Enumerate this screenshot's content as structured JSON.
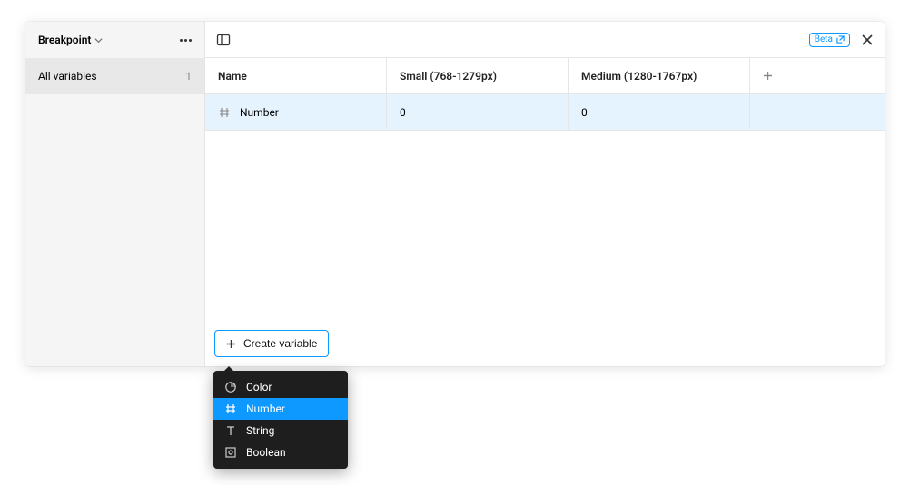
{
  "sidebar": {
    "collection_name": "Breakpoint",
    "groups": [
      {
        "label": "All variables",
        "count": "1"
      }
    ]
  },
  "header": {
    "beta_label": "Beta"
  },
  "table": {
    "columns": {
      "name": "Name",
      "modes": [
        "Small (768-1279px)",
        "Medium (1280-1767px)"
      ]
    },
    "rows": [
      {
        "name": "Number",
        "type_icon": "number-icon",
        "values": [
          "0",
          "0"
        ]
      }
    ]
  },
  "footer": {
    "create_label": "Create variable"
  },
  "menu": {
    "items": [
      {
        "icon": "color-icon",
        "label": "Color",
        "highlighted": false
      },
      {
        "icon": "number-icon",
        "label": "Number",
        "highlighted": true
      },
      {
        "icon": "string-icon",
        "label": "String",
        "highlighted": false
      },
      {
        "icon": "boolean-icon",
        "label": "Boolean",
        "highlighted": false
      }
    ]
  }
}
